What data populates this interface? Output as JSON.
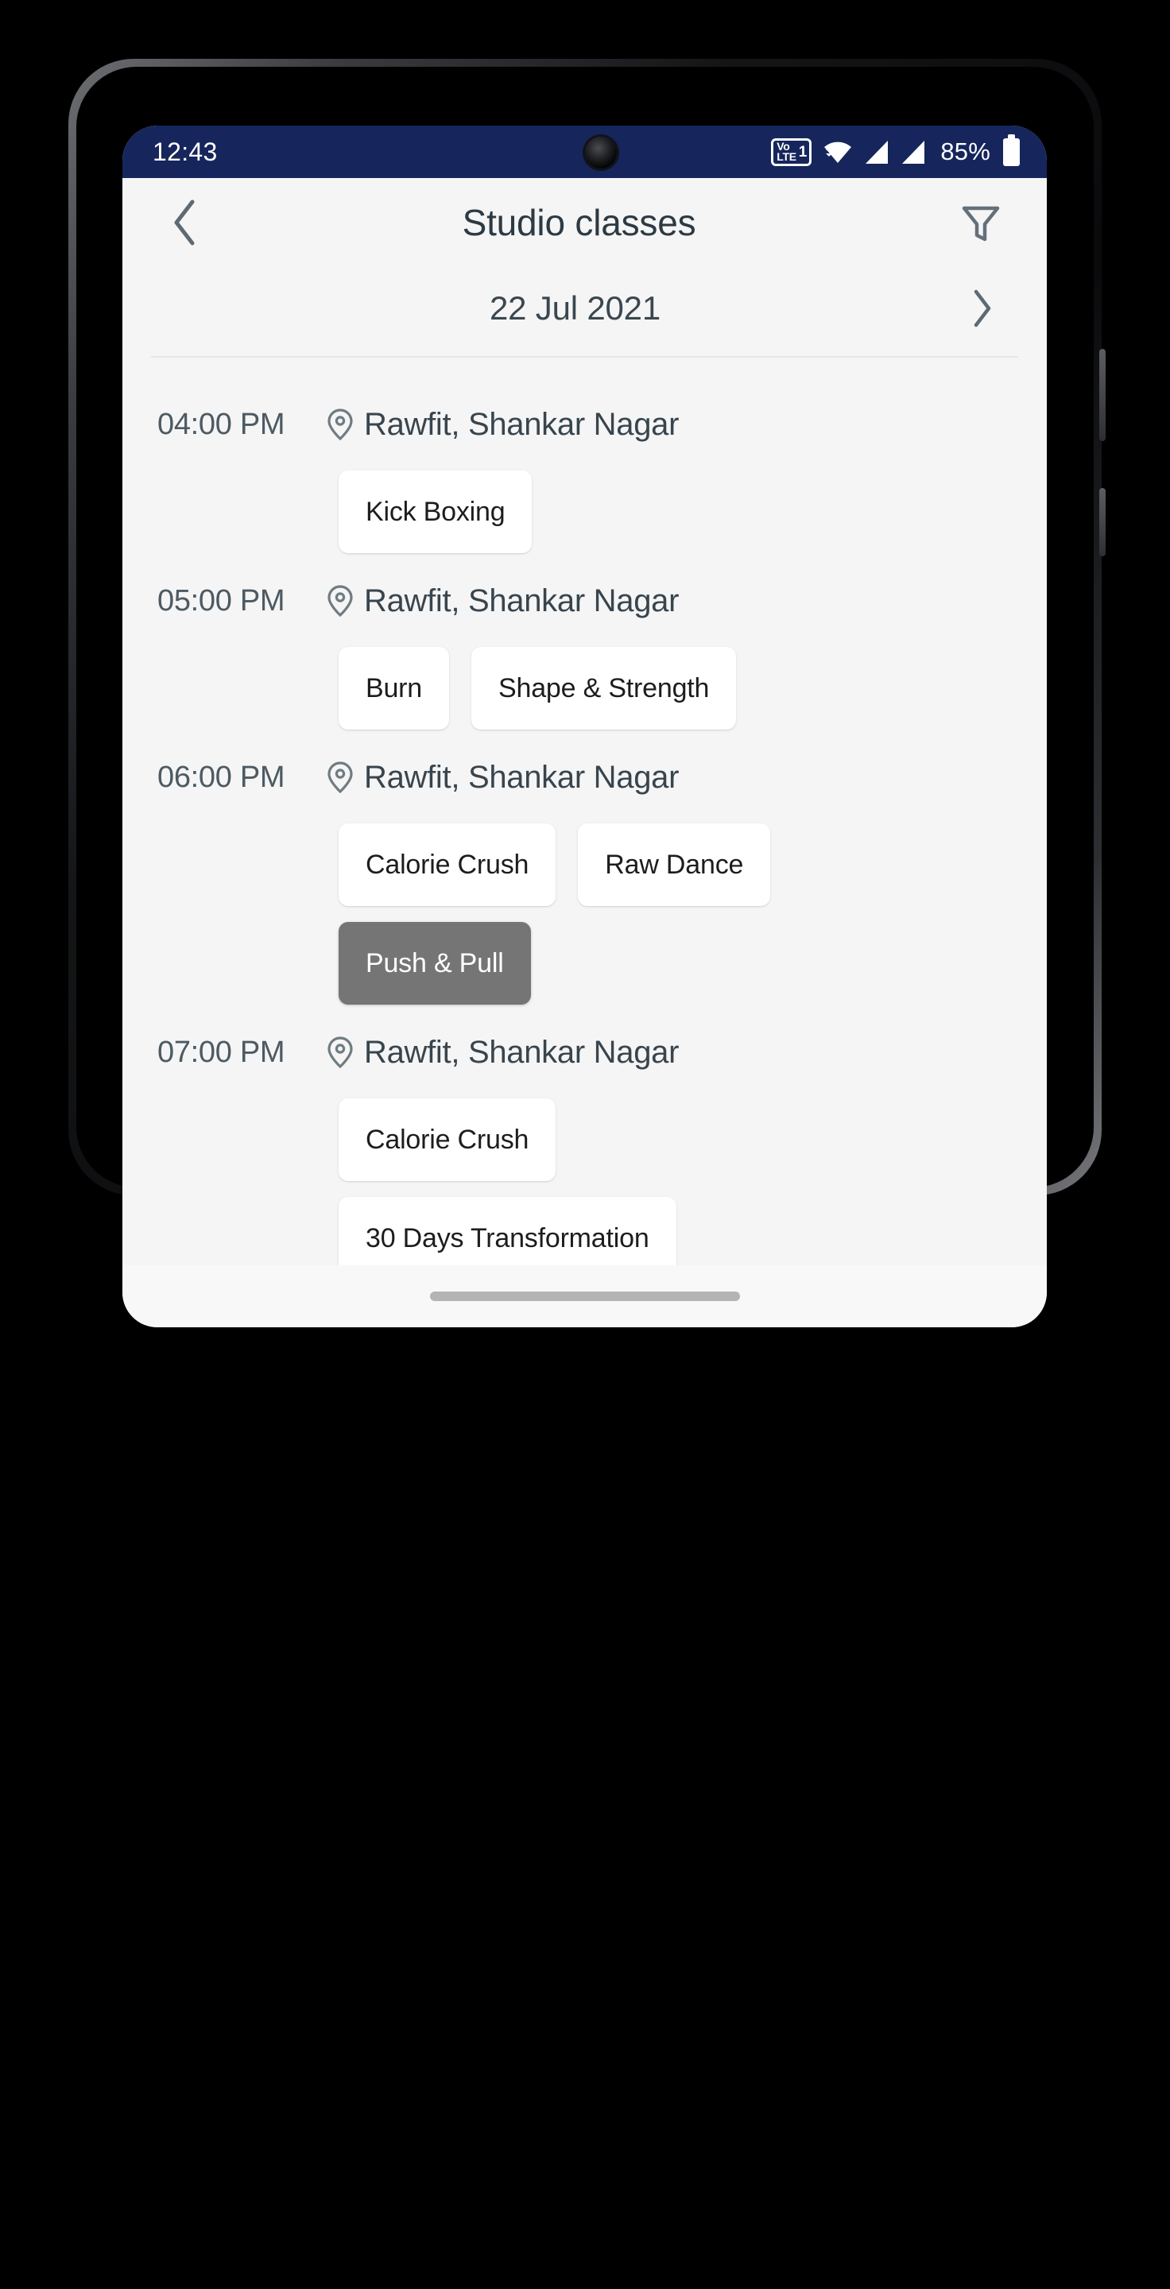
{
  "status_bar": {
    "clock": "12:43",
    "volte_label_top": "Vo",
    "volte_label_bottom": "LTE",
    "sim_number": "1",
    "battery_percent": "85%",
    "icons": [
      "volte-icon",
      "wifi-icon",
      "signal-bars-icon",
      "signal-bars-icon",
      "battery-icon"
    ],
    "background_color": "#16265c",
    "foreground_color": "#ffffff"
  },
  "header": {
    "back_label": "‹",
    "title": "Studio classes",
    "filter_label": "Filter",
    "icon_color": "#64707a"
  },
  "date_nav": {
    "date": "22 Jul 2021",
    "next_label": "›"
  },
  "theme": {
    "page_background": "#f5f5f6",
    "chip_background": "#ffffff",
    "chip_selected_background": "#757575",
    "chip_selected_text": "#ffffff",
    "text_primary": "#1d1d1d",
    "text_secondary": "#4d5a62",
    "divider": "#e6e7e8"
  },
  "schedule": {
    "slots": [
      {
        "time": "04:00 PM",
        "venue": "Rawfit, Shankar Nagar",
        "rows": [
          [
            {
              "name": "Kick Boxing",
              "selected": false
            }
          ]
        ]
      },
      {
        "time": "05:00 PM",
        "venue": "Rawfit, Shankar Nagar",
        "rows": [
          [
            {
              "name": "Burn",
              "selected": false
            },
            {
              "name": "Shape & Strength",
              "selected": false
            }
          ]
        ]
      },
      {
        "time": "06:00 PM",
        "venue": "Rawfit, Shankar Nagar",
        "rows": [
          [
            {
              "name": "Calorie Crush",
              "selected": false
            },
            {
              "name": "Raw Dance",
              "selected": false
            }
          ],
          [
            {
              "name": "Push & Pull",
              "selected": true
            }
          ]
        ]
      },
      {
        "time": "07:00 PM",
        "venue": "Rawfit, Shankar Nagar",
        "rows": [
          [
            {
              "name": "Calorie Crush",
              "selected": false
            }
          ],
          [
            {
              "name": "30 Days Transformation",
              "selected": false
            }
          ]
        ]
      }
    ]
  }
}
